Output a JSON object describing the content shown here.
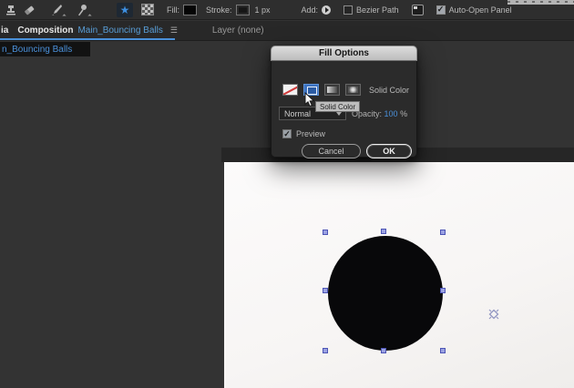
{
  "toolbar": {
    "fill_label": "Fill:",
    "stroke_label": "Stroke:",
    "stroke_width": "1 px",
    "add_label": "Add:",
    "bezier_path_label": "Bezier Path",
    "auto_open_label": "Auto-Open Panel",
    "check_glyph": "✓",
    "star_glyph": "★"
  },
  "tabs": {
    "left_fragment": "ia",
    "composition_label": "Composition",
    "composition_name": "Main_Bouncing Balls",
    "menu_glyph": "☰",
    "layer_tab_label": "Layer (none)",
    "dropdown_item": "n_Bouncing Balls"
  },
  "dialog": {
    "title": "Fill Options",
    "fill_type_label": "Solid Color",
    "tooltip": "Solid Color",
    "blend_mode": "Normal",
    "opacity_label": "Opacity:",
    "opacity_value": "100",
    "opacity_unit": "%",
    "preview_label": "Preview",
    "cancel_label": "Cancel",
    "ok_label": "OK"
  },
  "colors": {
    "accent_blue": "#3d8fe0",
    "link_blue": "#4a90d9",
    "handle_indigo": "#4d55b5",
    "dialog_body": "#2b2b2b",
    "toolbar_bg": "#2e2e2e",
    "canvas_white": "#fbfafa",
    "shape_black": "#08080a"
  }
}
